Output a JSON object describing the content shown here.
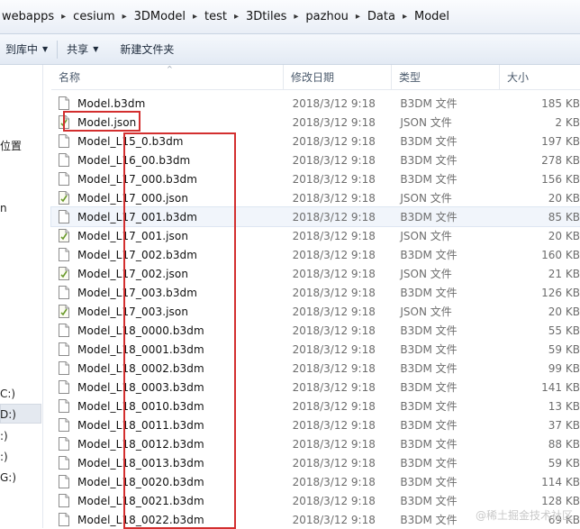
{
  "breadcrumb": [
    "webapps",
    "cesium",
    "3DModel",
    "test",
    "3Dtiles",
    "pazhou",
    "Data",
    "Model"
  ],
  "toolbar": {
    "include_label": "到库中",
    "share_label": "共享",
    "new_folder_label": "新建文件夹"
  },
  "nav": {
    "item_location": "位置",
    "item_n": "n",
    "drive_c": "C:)",
    "drive_d": "D:)",
    "drive_e": ":)",
    "drive_f": ":)",
    "drive_g": "G:)"
  },
  "columns": {
    "name": "名称",
    "date": "修改日期",
    "type": "类型",
    "size": "大小"
  },
  "files": [
    {
      "name": "Model.b3dm",
      "date": "2018/3/12 9:18",
      "type": "B3DM 文件",
      "size": "185 KB",
      "icon": "file-icon"
    },
    {
      "name": "Model.json",
      "date": "2018/3/12 9:18",
      "type": "JSON 文件",
      "size": "2 KB",
      "icon": "json-file-icon"
    },
    {
      "name": "Model_L15_0.b3dm",
      "date": "2018/3/12 9:18",
      "type": "B3DM 文件",
      "size": "197 KB",
      "icon": "file-icon"
    },
    {
      "name": "Model_L16_00.b3dm",
      "date": "2018/3/12 9:18",
      "type": "B3DM 文件",
      "size": "278 KB",
      "icon": "file-icon"
    },
    {
      "name": "Model_L17_000.b3dm",
      "date": "2018/3/12 9:18",
      "type": "B3DM 文件",
      "size": "156 KB",
      "icon": "file-icon"
    },
    {
      "name": "Model_L17_000.json",
      "date": "2018/3/12 9:18",
      "type": "JSON 文件",
      "size": "20 KB",
      "icon": "json-file-icon"
    },
    {
      "name": "Model_L17_001.b3dm",
      "date": "2018/3/12 9:18",
      "type": "B3DM 文件",
      "size": "85 KB",
      "icon": "file-icon"
    },
    {
      "name": "Model_L17_001.json",
      "date": "2018/3/12 9:18",
      "type": "JSON 文件",
      "size": "20 KB",
      "icon": "json-file-icon"
    },
    {
      "name": "Model_L17_002.b3dm",
      "date": "2018/3/12 9:18",
      "type": "B3DM 文件",
      "size": "160 KB",
      "icon": "file-icon"
    },
    {
      "name": "Model_L17_002.json",
      "date": "2018/3/12 9:18",
      "type": "JSON 文件",
      "size": "21 KB",
      "icon": "json-file-icon"
    },
    {
      "name": "Model_L17_003.b3dm",
      "date": "2018/3/12 9:18",
      "type": "B3DM 文件",
      "size": "126 KB",
      "icon": "file-icon"
    },
    {
      "name": "Model_L17_003.json",
      "date": "2018/3/12 9:18",
      "type": "JSON 文件",
      "size": "20 KB",
      "icon": "json-file-icon"
    },
    {
      "name": "Model_L18_0000.b3dm",
      "date": "2018/3/12 9:18",
      "type": "B3DM 文件",
      "size": "55 KB",
      "icon": "file-icon"
    },
    {
      "name": "Model_L18_0001.b3dm",
      "date": "2018/3/12 9:18",
      "type": "B3DM 文件",
      "size": "59 KB",
      "icon": "file-icon"
    },
    {
      "name": "Model_L18_0002.b3dm",
      "date": "2018/3/12 9:18",
      "type": "B3DM 文件",
      "size": "99 KB",
      "icon": "file-icon"
    },
    {
      "name": "Model_L18_0003.b3dm",
      "date": "2018/3/12 9:18",
      "type": "B3DM 文件",
      "size": "141 KB",
      "icon": "file-icon"
    },
    {
      "name": "Model_L18_0010.b3dm",
      "date": "2018/3/12 9:18",
      "type": "B3DM 文件",
      "size": "13 KB",
      "icon": "file-icon"
    },
    {
      "name": "Model_L18_0011.b3dm",
      "date": "2018/3/12 9:18",
      "type": "B3DM 文件",
      "size": "37 KB",
      "icon": "file-icon"
    },
    {
      "name": "Model_L18_0012.b3dm",
      "date": "2018/3/12 9:18",
      "type": "B3DM 文件",
      "size": "88 KB",
      "icon": "file-icon"
    },
    {
      "name": "Model_L18_0013.b3dm",
      "date": "2018/3/12 9:18",
      "type": "B3DM 文件",
      "size": "59 KB",
      "icon": "file-icon"
    },
    {
      "name": "Model_L18_0020.b3dm",
      "date": "2018/3/12 9:18",
      "type": "B3DM 文件",
      "size": "114 KB",
      "icon": "file-icon"
    },
    {
      "name": "Model_L18_0021.b3dm",
      "date": "2018/3/12 9:18",
      "type": "B3DM 文件",
      "size": "128 KB",
      "icon": "file-icon"
    },
    {
      "name": "Model_L18_0022.b3dm",
      "date": "2018/3/12 9:18",
      "type": "B3DM 文件",
      "size": "69 KB",
      "icon": "file-icon"
    }
  ],
  "watermark": "@稀土掘金技术社区"
}
